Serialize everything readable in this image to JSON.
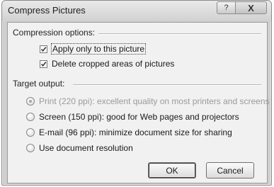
{
  "window": {
    "title": "Compress Pictures",
    "help_label": "?",
    "close_label": "X"
  },
  "compression": {
    "heading": "Compression options:",
    "options": [
      {
        "label": "Apply only to this picture",
        "checked": true
      },
      {
        "label": "Delete cropped areas of pictures",
        "checked": true
      }
    ]
  },
  "target": {
    "heading": "Target output:",
    "options": [
      {
        "label": "Print (220 ppi): excellent quality on most printers and screens",
        "selected": true,
        "enabled": false
      },
      {
        "label": "Screen (150 ppi): good for Web pages and projectors",
        "selected": false,
        "enabled": true
      },
      {
        "label": "E-mail (96 ppi): minimize document size for sharing",
        "selected": false,
        "enabled": true
      },
      {
        "label": "Use document resolution",
        "selected": false,
        "enabled": true
      }
    ]
  },
  "buttons": {
    "ok": "OK",
    "cancel": "Cancel"
  }
}
